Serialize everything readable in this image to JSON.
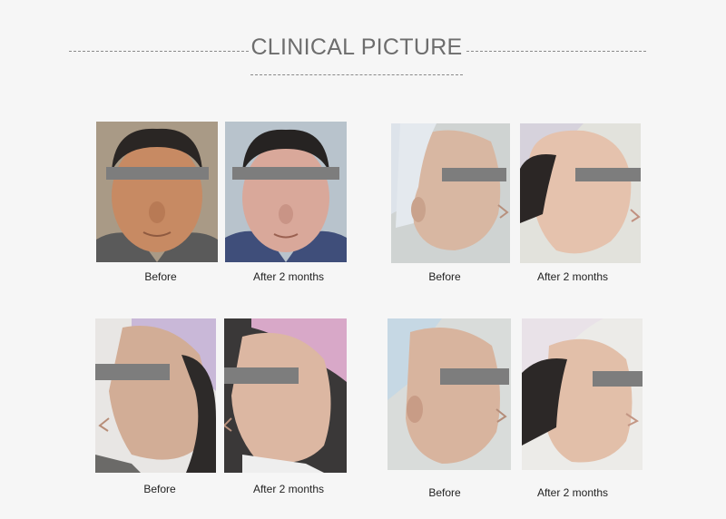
{
  "header": {
    "title": "CLINICAL PICTURE"
  },
  "captions": {
    "c1": "Before",
    "c2": "After 2 months",
    "c3": "Before",
    "c4": "After 2 months",
    "c5": "Before",
    "c6": "After 2 months",
    "c7": "Before",
    "c8": "After 2 months"
  },
  "colors": {
    "title": "#6d6d6d",
    "dash": "#8a8a8a",
    "privacy_bar": "#7d7d7d",
    "background": "#f6f6f6"
  }
}
